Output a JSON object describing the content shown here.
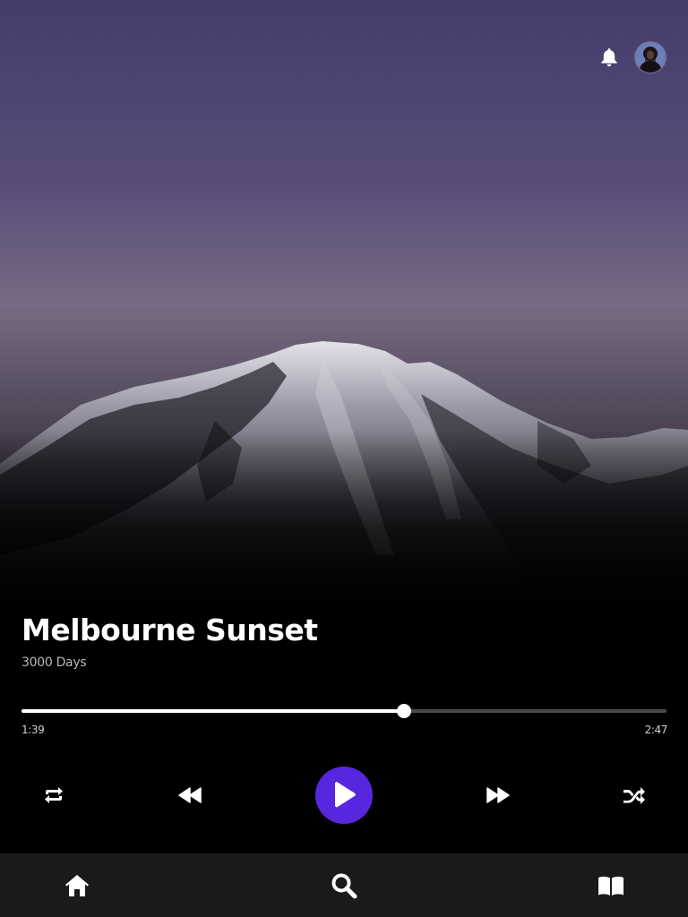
{
  "track": {
    "title": "Melbourne Sunset",
    "artist": "3000 Days"
  },
  "playback": {
    "elapsed": "1:39",
    "duration": "2:47",
    "progress_fraction": 0.593,
    "state": "paused"
  },
  "colors": {
    "accent": "#5727e0",
    "sky_top": "#463f6e",
    "sky_bottom": "#7a6a82",
    "background": "#000000",
    "nav_background": "#1a1a1d"
  },
  "top_bar": {
    "icons": [
      "bell-icon",
      "user-avatar"
    ]
  },
  "controls": {
    "icons": [
      "repeat-icon",
      "rewind-icon",
      "play-icon",
      "fast-forward-icon",
      "shuffle-icon"
    ]
  },
  "bottom_nav": {
    "items": [
      {
        "icon": "home-icon"
      },
      {
        "icon": "search-icon"
      },
      {
        "icon": "book-icon"
      }
    ]
  }
}
